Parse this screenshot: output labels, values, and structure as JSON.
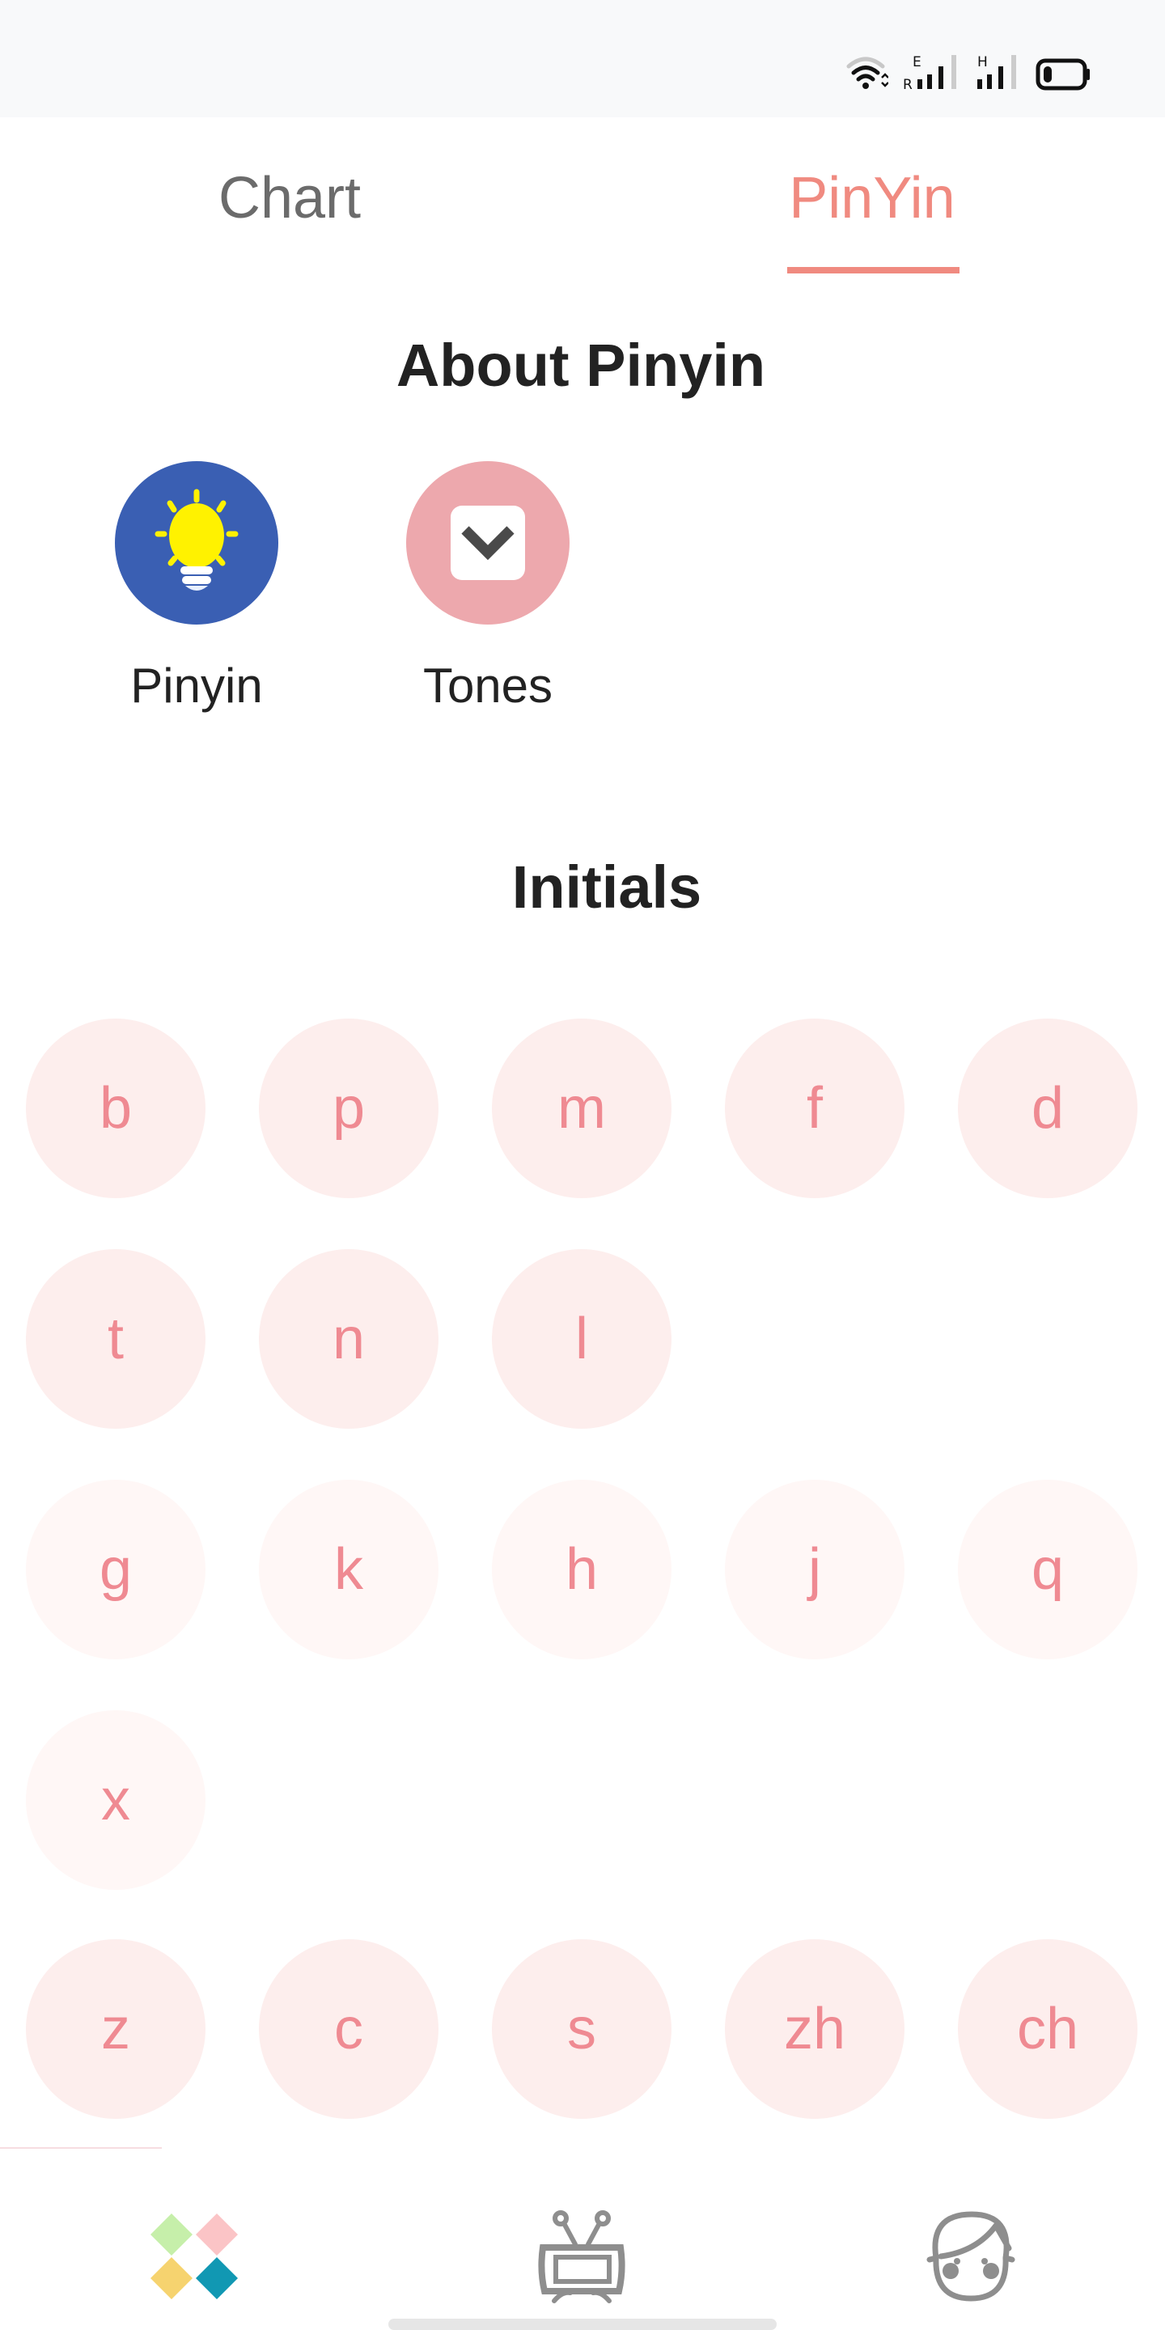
{
  "status_bar": {
    "icons": [
      "wifi-icon",
      "signal-1-icon",
      "signal-2-icon",
      "battery-icon"
    ],
    "signal_1_labels": [
      "E",
      "R"
    ],
    "signal_2_label": "H"
  },
  "tabs": [
    {
      "label": "Chart",
      "active": false
    },
    {
      "label": "PinYin",
      "active": true
    }
  ],
  "colors": {
    "accent": "#f08a80",
    "letter_text": "#ef8a92",
    "letter_bg": "#fdeeed",
    "letter_bg_light": "#fff7f6",
    "pinyin_icon_bg": "#3a5fb3",
    "tones_icon_bg": "#eda8ad"
  },
  "about": {
    "title": "About Pinyin",
    "items": [
      {
        "label": "Pinyin",
        "icon": "lightbulb-icon"
      },
      {
        "label": "Tones",
        "icon": "chevron-down-box-icon"
      }
    ]
  },
  "initials": {
    "title": "Initials",
    "groups": [
      [
        "b",
        "p",
        "m",
        "f",
        "d"
      ],
      [
        "t",
        "n",
        "l"
      ],
      [
        "g",
        "k",
        "h",
        "j",
        "q"
      ],
      [
        "x"
      ],
      [
        "z",
        "c",
        "s",
        "zh",
        "ch"
      ]
    ]
  },
  "bottom_nav": [
    {
      "name": "home",
      "icon": "colorful-diamonds-icon",
      "active": true
    },
    {
      "name": "tv",
      "icon": "tv-icon",
      "active": false
    },
    {
      "name": "profile",
      "icon": "boy-face-icon",
      "active": false
    }
  ]
}
